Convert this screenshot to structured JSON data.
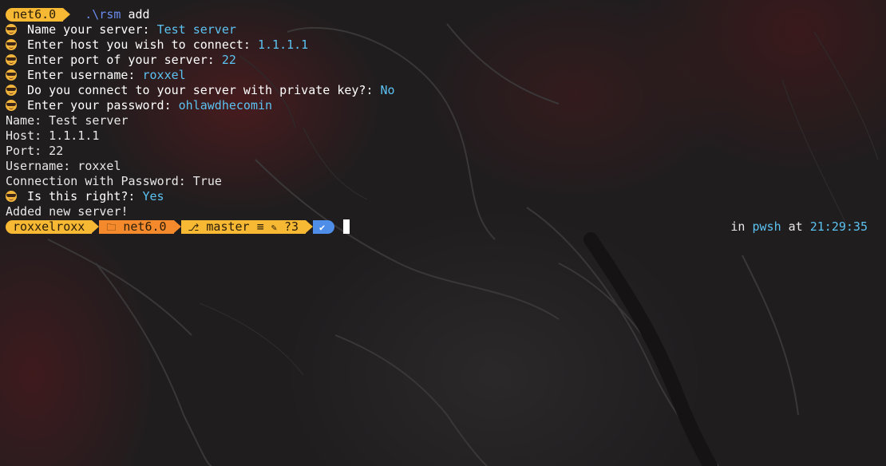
{
  "first_prompt": {
    "segment": "net6.0",
    "command_path": ".\\rsm",
    "command_arg": "add"
  },
  "questions": [
    {
      "label": "Name your server:",
      "answer": "Test server"
    },
    {
      "label": "Enter host you wish to connect:",
      "answer": "1.1.1.1"
    },
    {
      "label": "Enter port of your server:",
      "answer": "22"
    },
    {
      "label": "Enter username:",
      "answer": "roxxel"
    },
    {
      "label": "Do you connect to your server with private key?:",
      "answer": "No"
    },
    {
      "label": "Enter your password:",
      "answer": "ohlawdhecomin"
    }
  ],
  "summary": [
    "Name: Test server",
    "Host: 1.1.1.1",
    "Port: 22",
    "Username: roxxel",
    "Connection with Password: True"
  ],
  "confirm": {
    "label": "Is this right?:",
    "answer": "Yes"
  },
  "result": "Added new server!",
  "prompt": {
    "user": "roxxelroxx",
    "dir_icon": "folder-icon",
    "dir": "net6.0",
    "git_icon": "git-icon",
    "branch": "master",
    "git_status": "≡",
    "edit_icon": "edit-icon",
    "untracked": "?3",
    "ok_glyph": "✔",
    "right_in": "in",
    "shell": "pwsh",
    "right_at": "at",
    "time": "21:29:35"
  },
  "colors": {
    "prompt_yellow": "#f7b833",
    "prompt_orange": "#f48a2b",
    "prompt_blue": "#4f8ee8",
    "answer_cyan": "#5cc2f2",
    "path_blue": "#6b8cf0"
  }
}
